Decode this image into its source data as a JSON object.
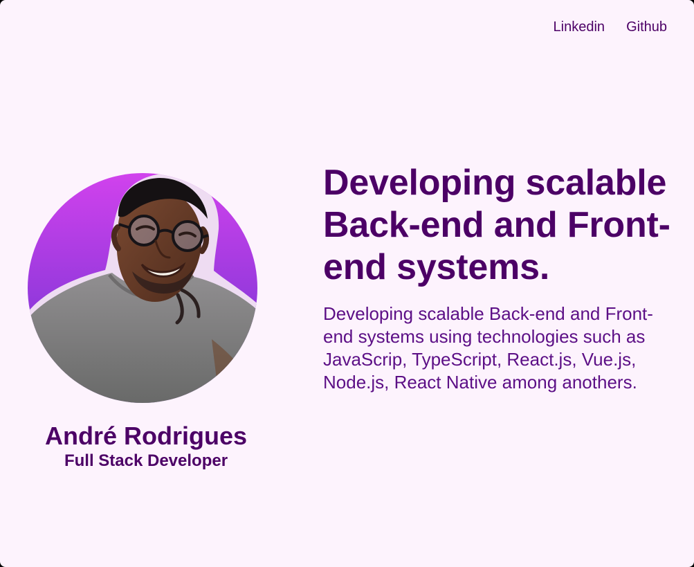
{
  "nav": {
    "items": [
      {
        "label": "Linkedin"
      },
      {
        "label": "Github"
      }
    ]
  },
  "profile": {
    "name": "André Rodrigues",
    "role": "Full Stack Developer"
  },
  "hero": {
    "headline": "Developing scalable Back-end and Front-end systems.",
    "description": "Developing scalable Back-end and Front-end systems using technologies such as JavaScrip, TypeScript, React.js, Vue.js, Node.js, React Native among anothers."
  },
  "colors": {
    "background": "#fdf3fd",
    "text": "#4c0066",
    "avatar_gradient_top": "#cf44ea",
    "avatar_gradient_bottom": "#6b35cc"
  }
}
